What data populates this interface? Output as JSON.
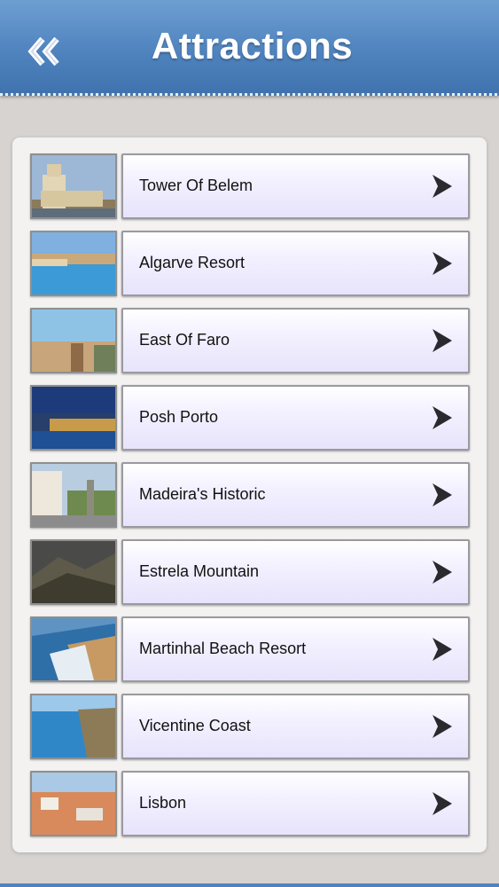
{
  "header": {
    "title": "Attractions",
    "back_icon": "double-chevron-left-icon",
    "color": "#4f83be"
  },
  "attractions": [
    {
      "label": "Tower Of Belem"
    },
    {
      "label": "Algarve Resort"
    },
    {
      "label": "East Of Faro"
    },
    {
      "label": "Posh Porto"
    },
    {
      "label": "Madeira's Historic"
    },
    {
      "label": "Estrela Mountain"
    },
    {
      "label": "Martinhal Beach Resort"
    },
    {
      "label": "Vicentine Coast"
    },
    {
      "label": "Lisbon"
    }
  ],
  "row_icon": "chevron-right-icon"
}
